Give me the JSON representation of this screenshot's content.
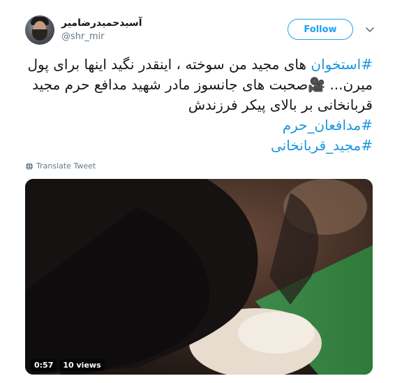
{
  "user": {
    "display_name": "آسیدحمیدرضامیر",
    "handle": "@shr_mir"
  },
  "follow_label": "Follow",
  "tweet": {
    "line1_hashtag": "#استخوان",
    "line1_rest": " های مجید من سوخته ، اینقدر نگید اینها برای پول",
    "line2_start": "میرن...",
    "line2_emoji": "🎥",
    "line2_rest": "صحبت های جانسوز مادر شهید مدافع حرم مجید",
    "line3": "قربانخانی بر بالای پیکر فرزندش",
    "hashtags": [
      "#مدافعان_حرم",
      "#مجید_قربانخانی"
    ]
  },
  "translate_label": "Translate Tweet",
  "video": {
    "duration": "0:57",
    "views": "10 views"
  },
  "colors": {
    "link_blue": "#1b95e0",
    "follow_blue": "#1da1f2",
    "secondary_text": "#657786"
  },
  "icons": {
    "more": "chevron-down-icon",
    "translate": "globe-icon"
  }
}
